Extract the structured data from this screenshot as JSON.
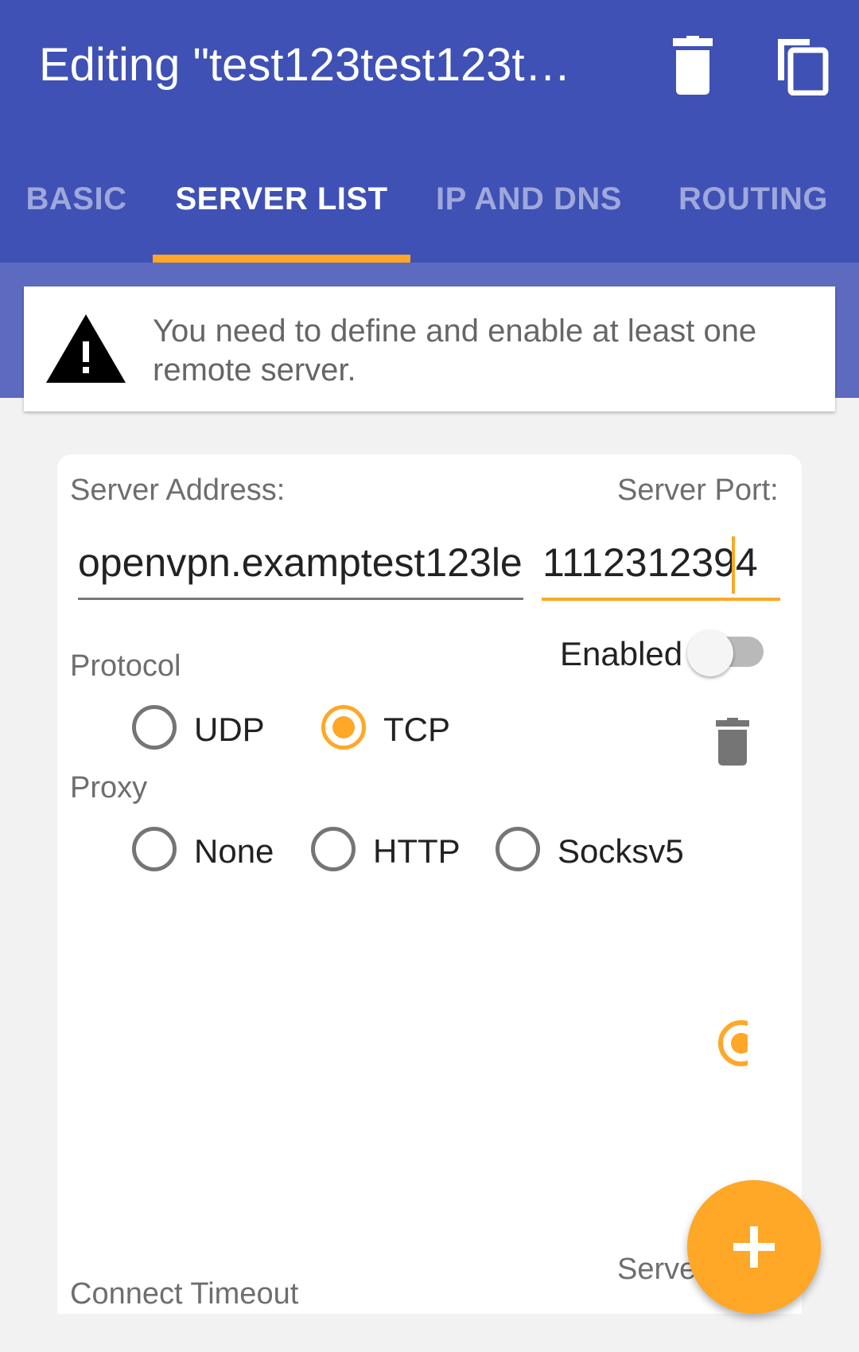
{
  "appbar": {
    "title": "Editing \"test123test123t…",
    "actions": [
      {
        "name": "delete-icon"
      },
      {
        "name": "copy-icon"
      }
    ]
  },
  "tabs": [
    {
      "label": "BASIC",
      "active": false
    },
    {
      "label": "SERVER LIST",
      "active": true
    },
    {
      "label": "IP AND DNS",
      "active": false
    },
    {
      "label": "ROUTING",
      "active": false
    }
  ],
  "warning": {
    "icon": "warning-triangle-icon",
    "text": "You need to define and enable at least one remote server."
  },
  "server": {
    "address_label": "Server Address:",
    "address_value": "openvpn.examptest123le",
    "port_label": "Server Port:",
    "port_value": "1112312394",
    "enabled_label": "Enabled",
    "enabled": false,
    "protocol_label": "Protocol",
    "protocol_options": [
      "UDP",
      "TCP"
    ],
    "protocol_selected": "TCP",
    "proxy_label": "Proxy",
    "proxy_options": [
      "None",
      "HTTP",
      "Socksv5"
    ],
    "proxy_selected": null,
    "partial_label": "Serve",
    "timeout_label": "Connect Timeout"
  },
  "fab": {
    "icon": "add-icon"
  },
  "colors": {
    "primary": "#3f51b5",
    "primary_light": "#5c6bc0",
    "accent": "#ffa726",
    "tab_inactive": "#9fa8da"
  }
}
